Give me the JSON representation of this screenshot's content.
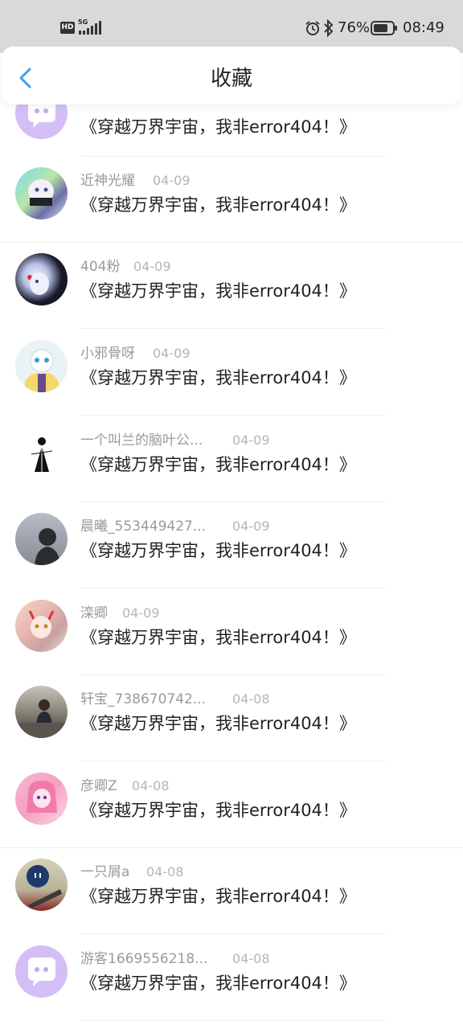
{
  "status_bar": {
    "network_type": "5G",
    "hd_badge": "HD",
    "battery_percent": "76%",
    "time": "08:49"
  },
  "header": {
    "title": "收藏"
  },
  "favorites": [
    {
      "name": "",
      "date": "",
      "title": "《穿越万界宇宙，我非error404！》",
      "avatar": "default-chat-avatar"
    },
    {
      "name": "近神光耀",
      "date": "04-09",
      "title": "《穿越万界宇宙，我非error404！》",
      "avatar": "anime-avatar"
    },
    {
      "name": "404粉",
      "date": "04-09",
      "title": "《穿越万界宇宙，我非error404！》",
      "avatar": "anime-avatar"
    },
    {
      "name": "小邪骨呀",
      "date": "04-09",
      "title": "《穿越万界宇宙，我非error404！》",
      "avatar": "anime-avatar"
    },
    {
      "name": "一个叫兰的脑叶公...",
      "date": "04-09",
      "title": "《穿越万界宇宙，我非error404！》",
      "avatar": "sketch-avatar"
    },
    {
      "name": "晨曦_553449427...",
      "date": "04-09",
      "title": "《穿越万界宇宙，我非error404！》",
      "avatar": "photo-avatar"
    },
    {
      "name": "滦卿",
      "date": "04-09",
      "title": "《穿越万界宇宙，我非error404！》",
      "avatar": "anime-avatar"
    },
    {
      "name": "轩宝_738670742...",
      "date": "04-08",
      "title": "《穿越万界宇宙，我非error404！》",
      "avatar": "photo-avatar"
    },
    {
      "name": "彦卿Z",
      "date": "04-08",
      "title": "《穿越万界宇宙，我非error404！》",
      "avatar": "anime-avatar"
    },
    {
      "name": "一只屑a",
      "date": "04-08",
      "title": "《穿越万界宇宙，我非error404！》",
      "avatar": "game-avatar"
    },
    {
      "name": "游客1669556218...",
      "date": "04-08",
      "title": "《穿越万界宇宙，我非error404！》",
      "avatar": "default-chat-avatar"
    }
  ],
  "colors": {
    "accent": "#3d9cf0",
    "default_avatar_bg": "#d3bff5",
    "text_primary": "#222222",
    "text_secondary": "#9a9a9a"
  }
}
